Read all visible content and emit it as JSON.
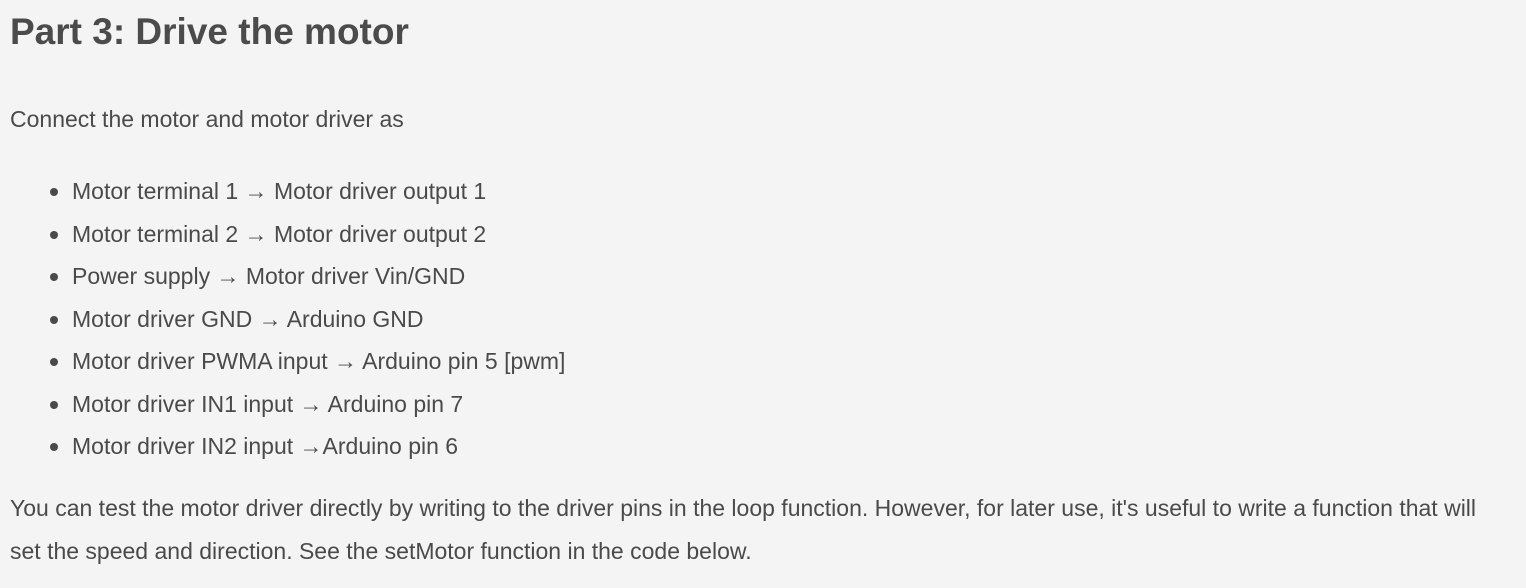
{
  "heading": "Part 3: Drive the motor",
  "intro": "Connect the motor and motor driver as",
  "connections": [
    "Motor terminal 1 → Motor driver output 1",
    "Motor terminal 2 → Motor driver output 2",
    "Power supply → Motor driver Vin/GND",
    "Motor driver GND → Arduino GND",
    "Motor driver PWMA input → Arduino pin 5 [pwm]",
    "Motor driver IN1 input → Arduino pin 7",
    "Motor driver IN2 input →Arduino pin 6"
  ],
  "paragraph": "You can test the motor driver directly by writing to the driver pins in the loop function. However, for later use, it's useful to write a function that will set the speed and direction. See the setMotor function in the code below."
}
